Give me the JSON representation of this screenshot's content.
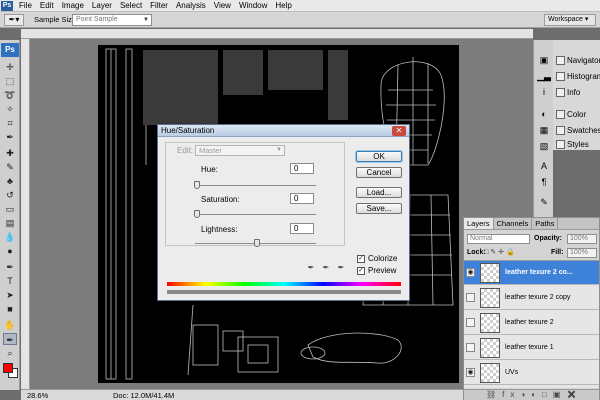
{
  "menubar": {
    "app_badge": "Ps",
    "items": [
      "File",
      "Edit",
      "Image",
      "Layer",
      "Select",
      "Filter",
      "Analysis",
      "View",
      "Window",
      "Help"
    ]
  },
  "options": {
    "sample_size_label": "Sample Size:",
    "sample_size_value": "Point Sample",
    "workspace_label": "Workspace"
  },
  "toolbox": {
    "logo": "Ps",
    "foreground_color": "#ff0000",
    "background_color": "#ffffff"
  },
  "status": {
    "zoom": "28.6%",
    "doc": "Doc: 12.0M/41.4M"
  },
  "dock": {
    "panels": [
      "Navigator",
      "Histogram",
      "Info",
      "Color",
      "Swatches",
      "Styles"
    ]
  },
  "hue_saturation": {
    "title": "Hue/Saturation",
    "edit_label": "Edit:",
    "edit_value": "Master",
    "hue_label": "Hue:",
    "hue_value": "0",
    "saturation_label": "Saturation:",
    "saturation_value": "0",
    "lightness_label": "Lightness:",
    "lightness_value": "0",
    "ok_label": "OK",
    "cancel_label": "Cancel",
    "load_label": "Load...",
    "save_label": "Save...",
    "colorize_label": "Colorize",
    "colorize_checked": true,
    "preview_label": "Preview",
    "preview_checked": true
  },
  "layers": {
    "tabs": [
      "Layers",
      "Channels",
      "Paths"
    ],
    "blend_mode": "Normal",
    "opacity_label": "Opacity:",
    "opacity_value": "100%",
    "lock_label": "Lock:",
    "fill_label": "Fill:",
    "fill_value": "100%",
    "rows": [
      {
        "name": "leather texure 2 co...",
        "visible": true,
        "selected": true
      },
      {
        "name": "leather texure 2 copy",
        "visible": false,
        "selected": false
      },
      {
        "name": "leather texure 2",
        "visible": false,
        "selected": false
      },
      {
        "name": "leather texure 1",
        "visible": false,
        "selected": false
      },
      {
        "name": "UVs",
        "visible": true,
        "selected": false
      }
    ]
  }
}
